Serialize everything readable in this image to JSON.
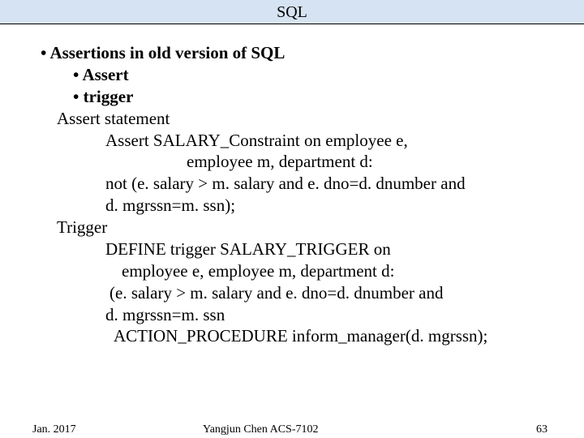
{
  "header": "SQL",
  "body": {
    "line1": "• Assertions in old version of SQL",
    "line2": "• Assert",
    "line3": "• trigger",
    "line4": "Assert statement",
    "line5": "Assert SALARY_Constraint on employee e,",
    "line6": "employee m, department d:",
    "line7": "not (e. salary > m. salary and e. dno=d. dnumber and",
    "line8": "d. mgrssn=m. ssn);",
    "line9": "Trigger",
    "line10": "DEFINE trigger SALARY_TRIGGER on",
    "line11": "employee e, employee m, department d:",
    "line12": " (e. salary > m. salary and e. dno=d. dnumber and",
    "line13": "d. mgrssn=m. ssn",
    "line14": " ACTION_PROCEDURE inform_manager(d. mgrssn);"
  },
  "footer": {
    "left": "Jan. 2017",
    "center": "Yangjun Chen     ACS-7102",
    "right": "63"
  }
}
